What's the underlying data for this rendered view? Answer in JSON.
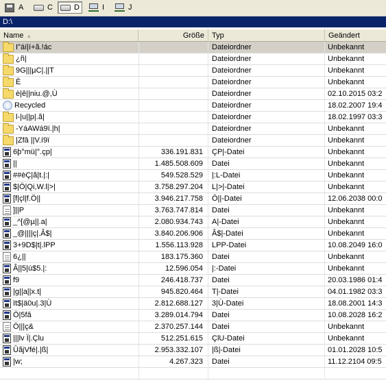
{
  "drives": [
    {
      "letter": "A",
      "icon": "floppy-drive-icon",
      "active": false
    },
    {
      "letter": "C",
      "icon": "hard-drive-icon",
      "active": false
    },
    {
      "letter": "D",
      "icon": "hard-drive-icon",
      "active": true
    },
    {
      "letter": "I",
      "icon": "network-drive-icon",
      "active": false
    },
    {
      "letter": "J",
      "icon": "network-drive-icon",
      "active": false
    }
  ],
  "path": "D:\\",
  "columns": {
    "name": "Name",
    "size": "Größe",
    "type": "Typ",
    "date": "Geändert"
  },
  "files": [
    {
      "name": "I\"áí|í+ã.!ác",
      "size": "",
      "type": "Dateiordner",
      "date": "Unbekannt",
      "icon": "folder",
      "selected": true
    },
    {
      "name": "¿ñ|",
      "size": "",
      "type": "Dateiordner",
      "date": "Unbekannt",
      "icon": "folder"
    },
    {
      "name": "9G|||µC|.||T",
      "size": "",
      "type": "Dateiordner",
      "date": "Unbekannt",
      "icon": "folder"
    },
    {
      "name": "È",
      "size": "",
      "type": "Dateiordner",
      "date": "Unbekannt",
      "icon": "folder"
    },
    {
      "name": "è|ê||niu.@,Ù",
      "size": "",
      "type": "Dateiordner",
      "date": "02.10.2015  03:2",
      "icon": "folder"
    },
    {
      "name": "Recycled",
      "size": "",
      "type": "Dateiordner",
      "date": "18.02.2007  19:4",
      "icon": "recycle"
    },
    {
      "name": "l-|u||p|.ã|",
      "size": "",
      "type": "Dateiordner",
      "date": "18.02.1997  03:3",
      "icon": "folder"
    },
    {
      "name": "-YáAWá9ï.|h|",
      "size": "",
      "type": "Dateiordner",
      "date": "Unbekannt",
      "icon": "folder"
    },
    {
      "name": "|Zfâ ||V.í9ï",
      "size": "",
      "type": "Dateiordner",
      "date": "Unbekannt",
      "icon": "folder"
    },
    {
      "name": "6þ°mü|°.çp|",
      "size": "336.191.831",
      "type": "ÇP|-Datei",
      "date": "Unbekannt",
      "icon": "exe"
    },
    {
      "name": "||",
      "size": "1.485.508.609",
      "type": "Datei",
      "date": "Unbekannt",
      "icon": "exe"
    },
    {
      "name": "##èÇ|ã|t.|:|",
      "size": "549.528.529",
      "type": "|:L-Datei",
      "date": "Unbekannt",
      "icon": "exe"
    },
    {
      "name": "$|Ö|Qi,W.l|>|",
      "size": "3.758.297.204",
      "type": "L|>|-Datei",
      "date": "Unbekannt",
      "icon": "exe"
    },
    {
      "name": "[f|çl|f.Ö||",
      "size": "3.946.217.758",
      "type": "Ö||-Datei",
      "date": "12.06.2038  00:0",
      "icon": "exe"
    },
    {
      "name": "]||P",
      "size": "3.763.747.814",
      "type": "Datei",
      "date": "Unbekannt",
      "icon": "doc"
    },
    {
      "name": "_^[@µ||.a|",
      "size": "2.080.934.743",
      "type": "A|-Datei",
      "date": "Unbekannt",
      "icon": "exe"
    },
    {
      "name": "_@||||ç|.Â$|",
      "size": "3.840.206.906",
      "type": "Â$|-Datei",
      "date": "Unbekannt",
      "icon": "exe"
    },
    {
      "name": "3+9D$|t|.lPP",
      "size": "1.556.113.928",
      "type": "LPP-Datei",
      "date": "10.08.2049  16:0",
      "icon": "exe"
    },
    {
      "name": "6¿||",
      "size": "183.175.360",
      "type": "Datei",
      "date": "Unbekannt",
      "icon": "doc"
    },
    {
      "name": "Â||5|ú$5.|:",
      "size": "12.596.054",
      "type": "|:-Datei",
      "date": "Unbekannt",
      "icon": "exe"
    },
    {
      "name": "f9",
      "size": "246.418.737",
      "type": "Datei",
      "date": "20.03.1986  01:4",
      "icon": "exe"
    },
    {
      "name": "|g||a||x.t|",
      "size": "945.820.464",
      "type": "T|-Datei",
      "date": "04.01.1982  03:3",
      "icon": "exe"
    },
    {
      "name": "ït$|ä0u|.3|Ù",
      "size": "2.812.688.127",
      "type": "3|Ù-Datei",
      "date": "18.08.2001  14:3",
      "icon": "exe"
    },
    {
      "name": "Ö|5fâ",
      "size": "3.289.014.794",
      "type": "Datei",
      "date": "10.08.2028  16:2",
      "icon": "exe"
    },
    {
      "name": "Ö|||ç&",
      "size": "2.370.257.144",
      "type": "Datei",
      "date": "Unbekannt",
      "icon": "doc"
    },
    {
      "name": "|||lv Ï|.Çlu",
      "size": "512.251.615",
      "type": "ÇlU-Datei",
      "date": "Unbekannt",
      "icon": "exe"
    },
    {
      "name": "ÛãjVfé|.|ß|",
      "size": "2.953.332.107",
      "type": "|ß|-Datei",
      "date": "01.01.2028  10:5",
      "icon": "exe"
    },
    {
      "name": "|w;",
      "size": "4.267.323",
      "type": "Datei",
      "date": "11.12.2104  09:5",
      "icon": "exe"
    }
  ]
}
